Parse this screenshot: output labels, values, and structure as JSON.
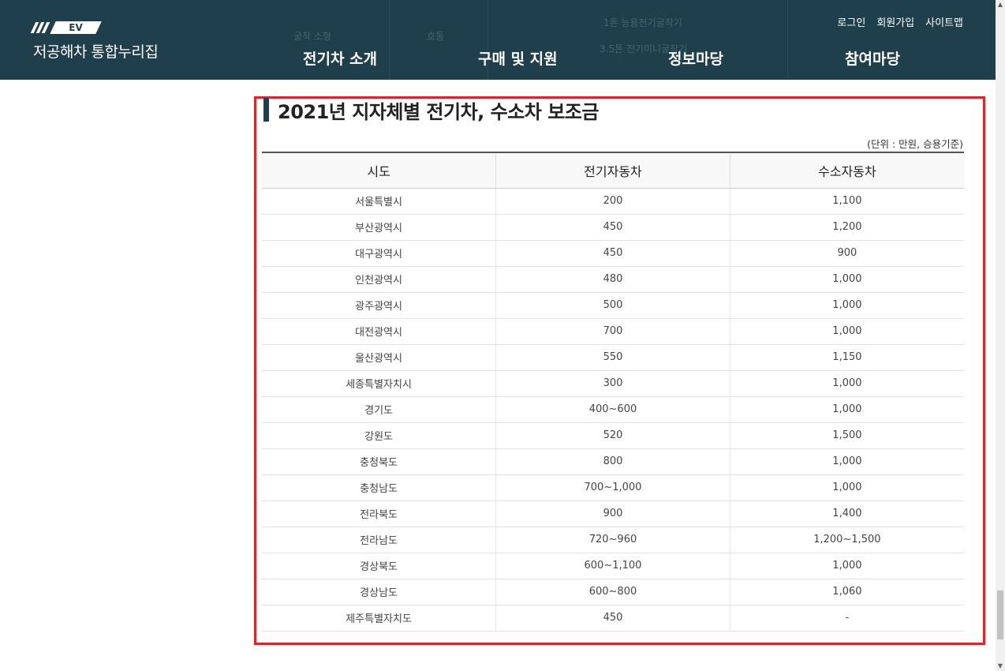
{
  "header": {
    "logo_badge": "EV",
    "logo_title": "저공해차 통합누리집",
    "util_links": [
      "로그인",
      "회원가입",
      "사이트맵"
    ],
    "nav": [
      "전기차 소개",
      "구매 및 지원",
      "정보마당",
      "참여마당"
    ],
    "ghost_texts": [
      "1톤 능용전기굴착기",
      "굴착 소형",
      "호통",
      "3.5톤 전기미니굴착기"
    ]
  },
  "content": {
    "title": "2021년 지자체별 전기차, 수소차 보조금",
    "unit_note": "(단위 : 만원, 승용기준)",
    "table": {
      "headers": [
        "시도",
        "전기자동차",
        "수소자동차"
      ],
      "rows": [
        [
          "서울특별시",
          "200",
          "1,100"
        ],
        [
          "부산광역시",
          "450",
          "1,200"
        ],
        [
          "대구광역시",
          "450",
          "900"
        ],
        [
          "인천광역시",
          "480",
          "1,000"
        ],
        [
          "광주광역시",
          "500",
          "1,000"
        ],
        [
          "대전광역시",
          "700",
          "1,000"
        ],
        [
          "울산광역시",
          "550",
          "1,150"
        ],
        [
          "세종특별자치시",
          "300",
          "1,000"
        ],
        [
          "경기도",
          "400~600",
          "1,000"
        ],
        [
          "강원도",
          "520",
          "1,500"
        ],
        [
          "충청북도",
          "800",
          "1,000"
        ],
        [
          "충청남도",
          "700~1,000",
          "1,000"
        ],
        [
          "전라북도",
          "900",
          "1,400"
        ],
        [
          "전라남도",
          "720~960",
          "1,200~1,500"
        ],
        [
          "경상북도",
          "600~1,100",
          "1,000"
        ],
        [
          "경상남도",
          "600~800",
          "1,060"
        ],
        [
          "제주특별자치도",
          "450",
          "-"
        ]
      ]
    }
  },
  "colors": {
    "header_bg": "#1e3f4b",
    "highlight_border": "#e2232a",
    "title_accent": "#1e3f4b"
  },
  "icons": {
    "logo": "ev-logo-icon",
    "scroll_up": "scroll-up-arrow-icon",
    "scroll_down": "scroll-down-arrow-icon"
  }
}
